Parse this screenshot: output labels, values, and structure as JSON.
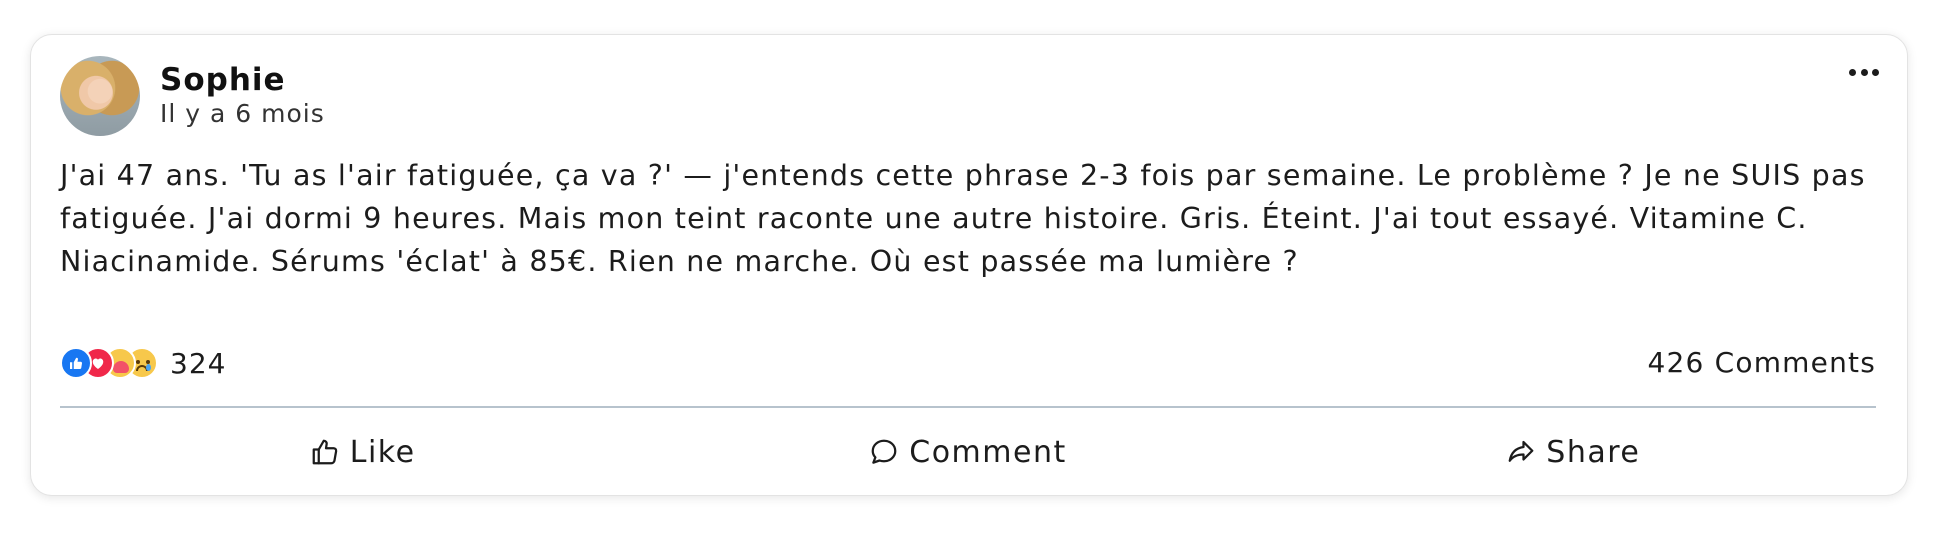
{
  "post": {
    "author": "Sophie",
    "time": "Il y a 6 mois",
    "text": "J'ai 47 ans. 'Tu as l'air fatiguée, ça va ?' — j'entends cette phrase 2-3 fois par semaine. Le problème ? Je ne SUIS pas fatiguée. J'ai dormi 9 heures. Mais mon teint raconte une autre histoire. Gris. Éteint. J'ai tout essayé. Vitamine C. Niacinamide. Sérums 'éclat' à 85€. Rien ne marche. Où est passée ma lumière ?",
    "reaction_icons": [
      "like-icon",
      "love-icon",
      "care-icon",
      "sad-icon"
    ],
    "reaction_count": "324",
    "comments_count": "426 Comments"
  },
  "actions": {
    "like_label": "Like",
    "comment_label": "Comment",
    "share_label": "Share"
  },
  "colors": {
    "like": "#1877f2",
    "love": "#f0284a",
    "care": "#f7c84b",
    "divider": "#b7c3cd"
  }
}
